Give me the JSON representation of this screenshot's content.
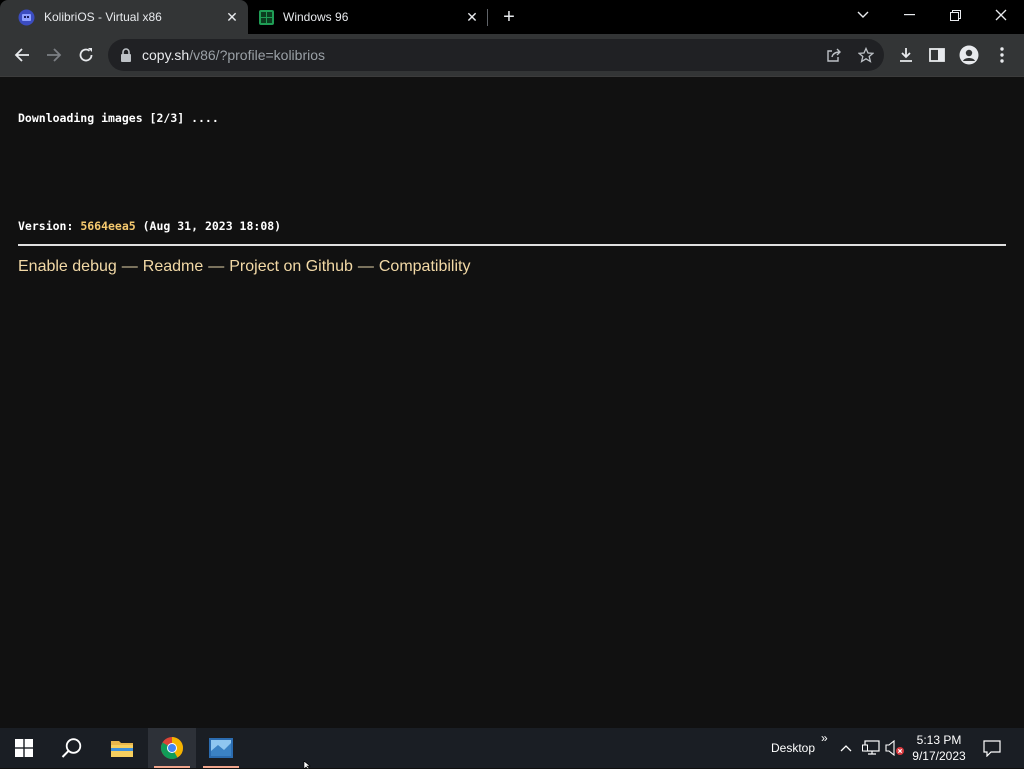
{
  "tabs": [
    {
      "title": "KolibriOS - Virtual x86",
      "active": true,
      "favicon": "v86-icon"
    },
    {
      "title": "Windows 96",
      "active": false,
      "favicon": "windows96-icon"
    }
  ],
  "tab_close_glyph": "✕",
  "new_tab_glyph": "+",
  "address_bar": {
    "host": "copy.sh",
    "path": "/v86/?profile=kolibrios"
  },
  "page": {
    "loading_text": "Downloading images [2/3] ....",
    "version_label": "Version: ",
    "version_hash": "5664eea5",
    "version_date": " (Aug 31, 2023 18:08)",
    "links": {
      "debug": "Enable debug",
      "readme": "Readme",
      "github": "Project on Github",
      "compat": "Compatibility",
      "separator": "—"
    }
  },
  "taskbar": {
    "desktop_label": "Desktop",
    "chevron": "»",
    "time": "5:13 PM",
    "date": "9/17/2023"
  },
  "colors": {
    "accent_link": "#f2d9a6",
    "version_hash": "#f5c96e",
    "page_bg": "#111111",
    "toolbar_bg": "#333536"
  }
}
